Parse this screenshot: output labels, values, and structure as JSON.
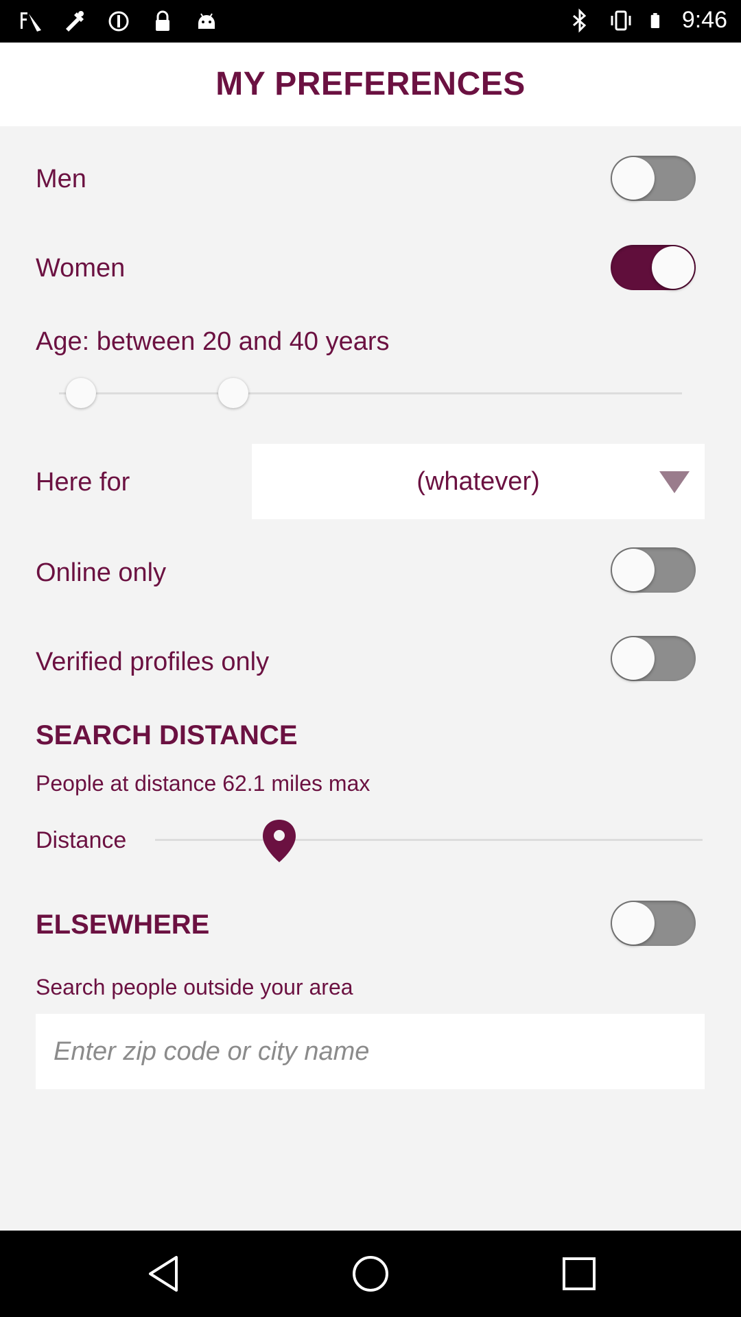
{
  "status_bar": {
    "time": "9:46",
    "left_icons": [
      "fake-gps-icon",
      "tools-icon",
      "sync-icon",
      "lock-icon",
      "android-icon"
    ],
    "right_icons": [
      "bluetooth-icon",
      "vibrate-icon",
      "battery-icon"
    ]
  },
  "header": {
    "title": "MY PREFERENCES"
  },
  "preferences": {
    "men": {
      "label": "Men",
      "on": false
    },
    "women": {
      "label": "Women",
      "on": true
    },
    "age": {
      "label": "Age: between 20 and 40 years",
      "min": 20,
      "max": 40
    },
    "here_for": {
      "label": "Here for",
      "value": "(whatever)"
    },
    "online_only": {
      "label": "Online only",
      "on": false
    },
    "verified_only": {
      "label": "Verified profiles only",
      "on": false
    }
  },
  "search_distance": {
    "title": "SEARCH DISTANCE",
    "summary": "People at distance 62.1 miles max",
    "slider_label": "Distance",
    "value_miles": 62.1
  },
  "elsewhere": {
    "title": "ELSEWHERE",
    "on": false,
    "subtitle": "Search people outside your area",
    "input_placeholder": "Enter zip code or city name",
    "input_value": ""
  },
  "colors": {
    "accent": "#6b1141",
    "toggle_on": "#600e3b",
    "toggle_off": "#8d8d8d",
    "background": "#f3f3f3"
  },
  "nav_bar": {
    "buttons": [
      "back-icon",
      "home-icon",
      "recents-icon"
    ]
  }
}
